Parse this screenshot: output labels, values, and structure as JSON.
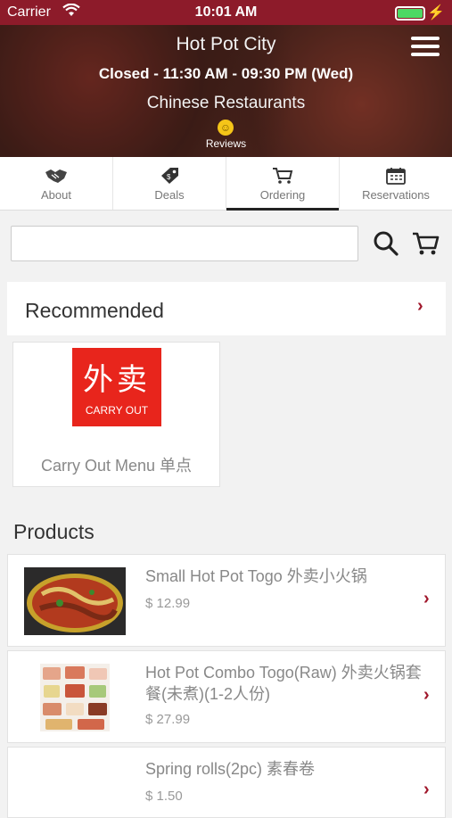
{
  "status": {
    "carrier": "Carrier",
    "time": "10:01 AM"
  },
  "header": {
    "title": "Hot Pot City",
    "hours": "Closed - 11:30 AM - 09:30 PM (Wed)",
    "category": "Chinese Restaurants",
    "reviews": "Reviews"
  },
  "tabs": [
    {
      "label": "About",
      "icon": "handshake-icon"
    },
    {
      "label": "Deals",
      "icon": "tag-icon"
    },
    {
      "label": "Ordering",
      "icon": "cart-icon"
    },
    {
      "label": "Reservations",
      "icon": "calendar-icon"
    }
  ],
  "search": {
    "value": "",
    "placeholder": ""
  },
  "recommended": {
    "title": "Recommended",
    "items": [
      {
        "name": "Carry Out Menu 单点",
        "logo_zh": "外卖",
        "logo_en": "CARRY OUT"
      }
    ]
  },
  "products": {
    "title": "Products",
    "items": [
      {
        "name": "Small Hot Pot Togo 外卖小火锅",
        "price": "$ 12.99"
      },
      {
        "name": "Hot Pot Combo Togo(Raw) 外卖火锅套餐(未煮)(1-2人份)",
        "price": "$ 27.99"
      },
      {
        "name": "Spring rolls(2pc) 素春卷",
        "price": "$ 1.50"
      }
    ]
  },
  "colors": {
    "brand": "#8d1b2a",
    "accent": "#a0172b",
    "battery": "#4cd964",
    "carry_out_red": "#e8251c"
  }
}
